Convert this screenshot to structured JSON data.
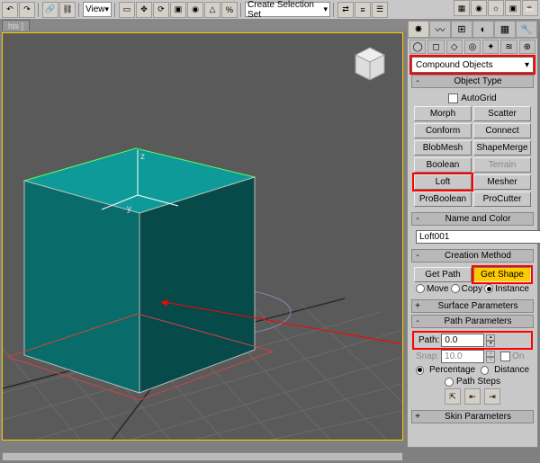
{
  "toolbar": {
    "view_label": "View",
    "selset": "Create Selection Set"
  },
  "tab": "hts ]",
  "cmd": {
    "category": "Compound Objects",
    "obj_type": "Object Type",
    "autogrid": "AutoGrid",
    "b": [
      "Morph",
      "Scatter",
      "Conform",
      "Connect",
      "BlobMesh",
      "ShapeMerge",
      "Boolean",
      "Terrain",
      "Loft",
      "Mesher",
      "ProBoolean",
      "ProCutter"
    ],
    "name_color": "Name and Color",
    "name": "Loft001",
    "creation": "Creation Method",
    "get_path": "Get Path",
    "get_shape": "Get Shape",
    "move": "Move",
    "copy": "Copy",
    "instance": "Instance",
    "surf": "Surface Parameters",
    "path_params": "Path Parameters",
    "path_lbl": "Path:",
    "path_val": "0.0",
    "snap_lbl": "Snap:",
    "snap_val": "10.0",
    "on": "On",
    "pct": "Percentage",
    "dist": "Distance",
    "steps": "Path Steps",
    "skin": "Skin Parameters"
  }
}
